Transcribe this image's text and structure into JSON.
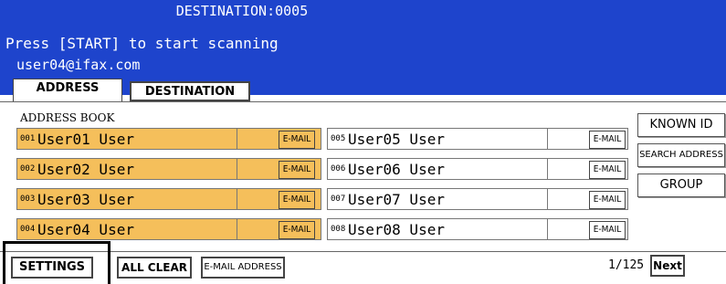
{
  "header": {
    "destination": "DESTINATION:0005",
    "instruction": "Press [START] to start scanning",
    "email": "user04@ifax.com"
  },
  "tabs": {
    "address": "ADDRESS",
    "destination": "DESTINATION"
  },
  "section_label": "ADDRESS BOOK",
  "entries": [
    {
      "num": "001",
      "name": "User01 User",
      "tag": "E-MAIL",
      "selected": true
    },
    {
      "num": "002",
      "name": "User02 User",
      "tag": "E-MAIL",
      "selected": true
    },
    {
      "num": "003",
      "name": "User03 User",
      "tag": "E-MAIL",
      "selected": true
    },
    {
      "num": "004",
      "name": "User04 User",
      "tag": "E-MAIL",
      "selected": true
    },
    {
      "num": "005",
      "name": "User05 User",
      "tag": "E-MAIL",
      "selected": false
    },
    {
      "num": "006",
      "name": "User06 User",
      "tag": "E-MAIL",
      "selected": false
    },
    {
      "num": "007",
      "name": "User07 User",
      "tag": "E-MAIL",
      "selected": false
    },
    {
      "num": "008",
      "name": "User08 User",
      "tag": "E-MAIL",
      "selected": false
    }
  ],
  "side_buttons": {
    "known_id": "KNOWN ID",
    "search_address": "SEARCH ADDRESS",
    "group": "GROUP"
  },
  "bottom": {
    "settings": "SETTINGS",
    "all_clear": "ALL CLEAR",
    "email_address": "E-MAIL ADDRESS",
    "page": "1/125",
    "next": "Next"
  },
  "colors": {
    "banner": "#1e44cc",
    "selected": "#f5bf5b"
  }
}
